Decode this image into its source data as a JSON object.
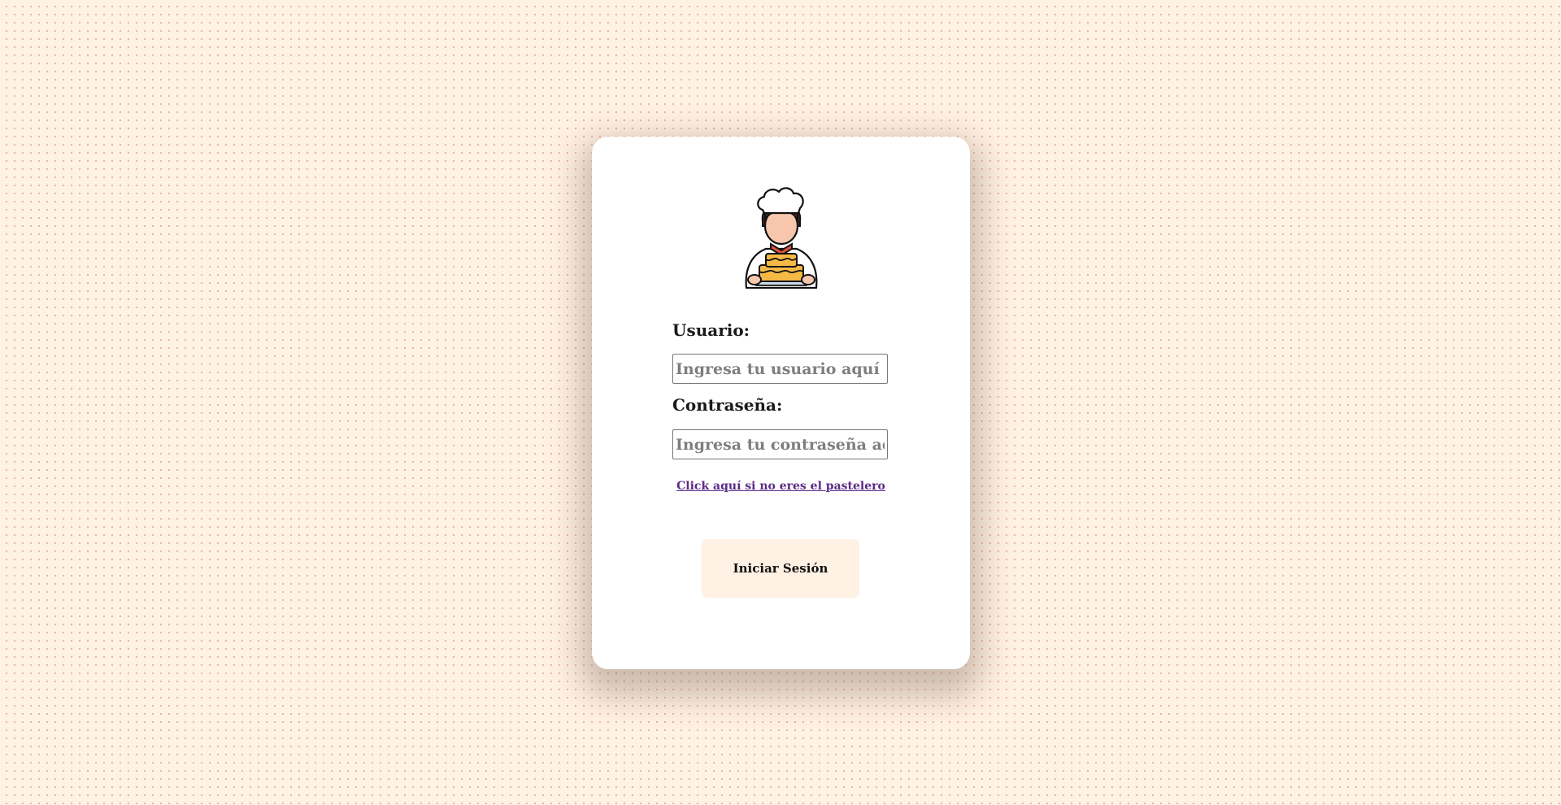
{
  "login": {
    "logo_icon": "chef-holding-cake-icon",
    "username_label": "Usuario:",
    "username_placeholder": "Ingresa tu usuario aquí",
    "username_value": "",
    "password_label": "Contraseña:",
    "password_placeholder": "Ingresa tu contraseña aquí",
    "password_value": "",
    "not_baker_link": "Click aquí si no eres el pastelero",
    "submit_label": "Iniciar Sesión"
  },
  "colors": {
    "background": "#fff1e4",
    "background_dots": "#e8b8a8",
    "card": "#ffffff",
    "button": "#fff1e4",
    "link": "#5b2a86"
  }
}
